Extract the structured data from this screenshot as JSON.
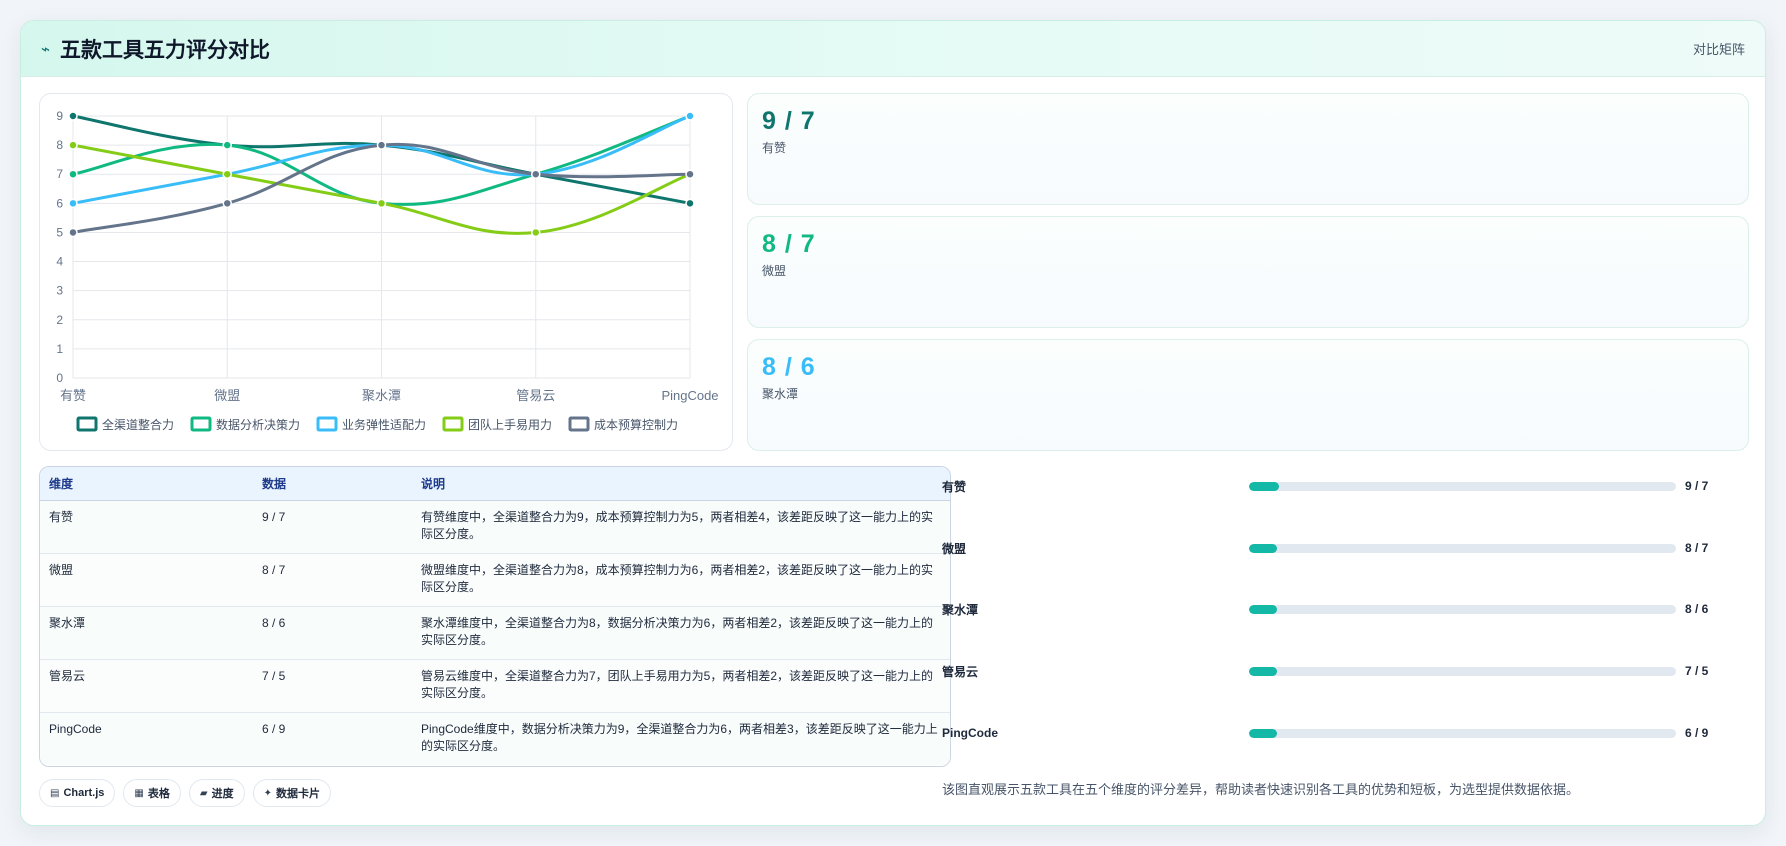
{
  "header": {
    "title": "五款工具五力评分对比",
    "title_icon": "⌁",
    "tag": "对比矩阵"
  },
  "chart_data": {
    "type": "line",
    "categories": [
      "有赞",
      "微盟",
      "聚水潭",
      "管易云",
      "PingCode"
    ],
    "ylim": [
      0,
      9
    ],
    "yticks": [
      "0",
      "1",
      "2",
      "3",
      "4",
      "5",
      "6",
      "7",
      "8",
      "9"
    ],
    "grid": true,
    "legend_position": "bottom",
    "series": [
      {
        "name": "全渠道整合力",
        "color": "#0f766e",
        "values": [
          9,
          8,
          8,
          7,
          6
        ]
      },
      {
        "name": "数据分析决策力",
        "color": "#10b981",
        "values": [
          7,
          8,
          6,
          7,
          9
        ]
      },
      {
        "name": "业务弹性适配力",
        "color": "#38bdf8",
        "values": [
          6,
          7,
          8,
          7,
          9
        ]
      },
      {
        "name": "团队上手易用力",
        "color": "#84cc16",
        "values": [
          8,
          7,
          6,
          5,
          7
        ]
      },
      {
        "name": "成本预算控制力",
        "color": "#64748b",
        "values": [
          5,
          6,
          8,
          7,
          7
        ]
      }
    ]
  },
  "kpis": [
    {
      "value": "9 / 7",
      "label": "有赞",
      "color": "#0f766e"
    },
    {
      "value": "8 / 7",
      "label": "微盟",
      "color": "#10b981"
    },
    {
      "value": "8 / 6",
      "label": "聚水潭",
      "color": "#38bdf8"
    }
  ],
  "table": {
    "headers": [
      "维度",
      "数据",
      "说明"
    ],
    "rows": [
      {
        "dim": "有赞",
        "data": "9 / 7",
        "desc": "有赞维度中，全渠道整合力为9，成本预算控制力为5，两者相差4，该差距反映了这一能力上的实际区分度。"
      },
      {
        "dim": "微盟",
        "data": "8 / 7",
        "desc": "微盟维度中，全渠道整合力为8，成本预算控制力为6，两者相差2，该差距反映了这一能力上的实际区分度。"
      },
      {
        "dim": "聚水潭",
        "data": "8 / 6",
        "desc": "聚水潭维度中，全渠道整合力为8，数据分析决策力为6，两者相差2，该差距反映了这一能力上的实际区分度。"
      },
      {
        "dim": "管易云",
        "data": "7 / 5",
        "desc": "管易云维度中，全渠道整合力为7，团队上手易用力为5，两者相差2，该差距反映了这一能力上的实际区分度。"
      },
      {
        "dim": "PingCode",
        "data": "6 / 9",
        "desc": "PingCode维度中，数据分析决策力为9，全渠道整合力为6，两者相差3，该差距反映了这一能力上的实际区分度。"
      }
    ]
  },
  "progress": [
    {
      "name": "有赞",
      "value": "9 / 7",
      "fill_fraction": 0.07
    },
    {
      "name": "微盟",
      "value": "8 / 7",
      "fill_fraction": 0.065
    },
    {
      "name": "聚水潭",
      "value": "8 / 6",
      "fill_fraction": 0.065
    },
    {
      "name": "管易云",
      "value": "7 / 5",
      "fill_fraction": 0.065
    },
    {
      "name": "PingCode",
      "value": "6 / 9",
      "fill_fraction": 0.065
    }
  ],
  "footnote": "该图直观展示五款工具在五个维度的评分差异，帮助读者快速识别各工具的优势和短板，为选型提供数据依据。",
  "chips": [
    {
      "icon": "▤",
      "label": "Chart.js"
    },
    {
      "icon": "▦",
      "label": "表格"
    },
    {
      "icon": "▰",
      "label": "进度"
    },
    {
      "icon": "✦",
      "label": "数据卡片"
    }
  ]
}
